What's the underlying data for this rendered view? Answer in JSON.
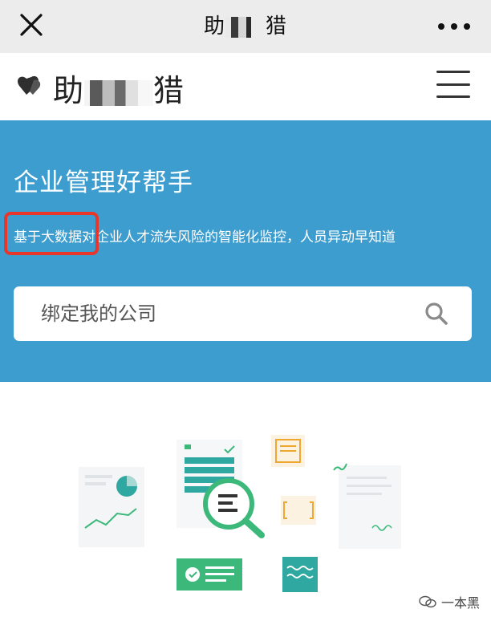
{
  "wechat_bar": {
    "title_start": "助",
    "title_end": "猎",
    "close_icon": "close-icon",
    "more_icon": "more-dots-icon"
  },
  "header": {
    "brand_start": "助",
    "brand_end": "猎",
    "logo_icon": "heart-logo-icon",
    "menu_icon": "hamburger-menu-icon"
  },
  "hero": {
    "headline": "企业管理好帮手",
    "tagline": "基于大数据对企业人才流失风险的智能化监控，人员异动早知道",
    "search": {
      "placeholder": "绑定我的公司",
      "icon": "search-icon"
    }
  },
  "watermark": {
    "label": "一本黑",
    "icon": "wechat-official-account-icon"
  },
  "colors": {
    "hero_bg": "#3d9dce",
    "top_bar_bg": "#ececec",
    "highlight_border": "#e8362b",
    "illustration_green": "#3bb87a",
    "illustration_teal": "#2ea8a0",
    "illustration_orange": "#f0a732"
  }
}
